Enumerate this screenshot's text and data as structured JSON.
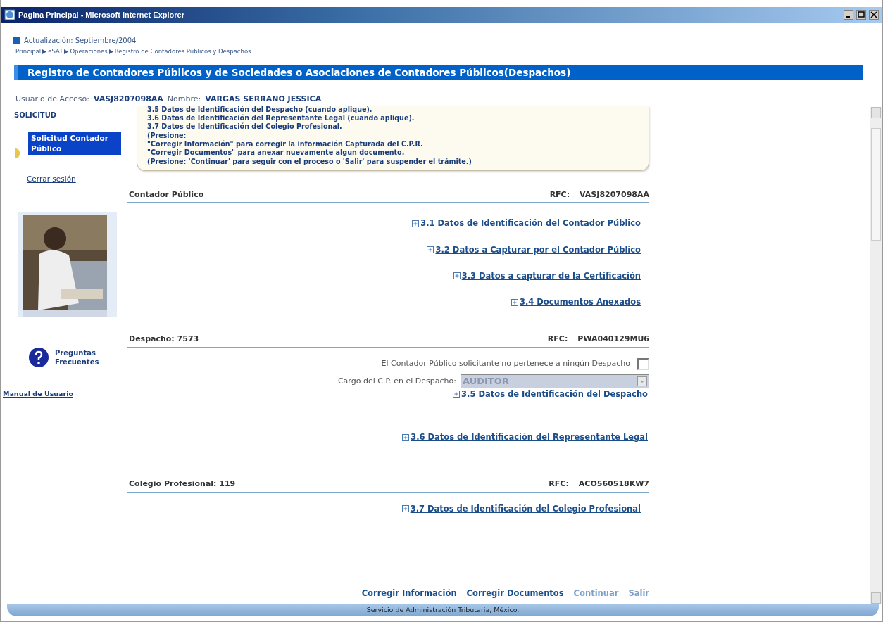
{
  "window": {
    "title": "Pagina Principal - Microsoft Internet Explorer"
  },
  "header": {
    "update": "Actualización: Septiembre/2004",
    "breadcrumb": [
      "Principal",
      "eSAT",
      "Operaciones",
      "Registro de Contadores Públicos y Despachos"
    ],
    "banner": "Registro de Contadores Públicos y de Sociedades o Asociaciones de Contadores Públicos(Despachos)"
  },
  "user": {
    "access_label": "Usuario de Acceso:",
    "access_value": "VASJ8207098AA",
    "name_label": "Nombre:",
    "name_value": "VARGAS SERRANO JESSICA"
  },
  "sidebar": {
    "section": "SOLICITUD",
    "items": [
      {
        "label": "Solicitud Contador Público",
        "selected": true
      }
    ],
    "logout": "Cerrar sesión",
    "faq": "Preguntas Frecuentes",
    "manual": "Manual de Usuario"
  },
  "instructions": [
    "3.5 Datos de Identificación del Despacho (cuando aplique).",
    "3.6 Datos de Identificación del Representante Legal (cuando aplique).",
    "3.7 Datos de Identificación del Colegio Profesional.",
    "(Presione:",
    "\"Corregir Información\" para corregir la información Capturada del C.P.R.",
    "\"Corregir Documentos\" para anexar nuevamente algun documento.",
    "(Presione: 'Continuar' para seguir con el proceso o 'Salir' para suspender el trámite.)"
  ],
  "sections": [
    {
      "title": "Contador Público",
      "rfc_label": "RFC:",
      "rfc": "VASJ8207098AA",
      "items": [
        {
          "kind": "link",
          "label": "3.1 Datos de Identificación del Contador Público"
        },
        {
          "kind": "link",
          "label": "3.2 Datos a Capturar por el Contador Público"
        },
        {
          "kind": "link",
          "label": "3.3 Datos a capturar de la Certificación"
        },
        {
          "kind": "link",
          "label": "3.4 Documentos Anexados"
        }
      ]
    },
    {
      "title": "Despacho: 7573",
      "rfc_label": "RFC:",
      "rfc": "PWA040129MU6",
      "items": [
        {
          "kind": "checkbox",
          "label": "El Contador Público solicitante no pertenece a ningún Despacho",
          "checked": false
        },
        {
          "kind": "select",
          "label": "Cargo del C.P. en el Despacho:",
          "value": "AUDITOR",
          "disabled": true
        },
        {
          "kind": "link",
          "label": "3.5 Datos de Identificación del Despacho"
        },
        {
          "kind": "link",
          "label": "3.6 Datos de Identificación del Representante Legal"
        }
      ]
    },
    {
      "title": "Colegio Profesional: 119",
      "rfc_label": "RFC:",
      "rfc": "ACO560518KW7",
      "items": [
        {
          "kind": "link",
          "label": "3.7 Datos de Identificación del Colegio Profesional"
        }
      ]
    }
  ],
  "actions": [
    {
      "label": "Corregir Información",
      "disabled": false
    },
    {
      "label": "Corregir Documentos",
      "disabled": false
    },
    {
      "label": "Continuar",
      "disabled": true
    },
    {
      "label": "Salir",
      "disabled": true
    }
  ],
  "footer": "Servicio de Administración Tributaria, México."
}
